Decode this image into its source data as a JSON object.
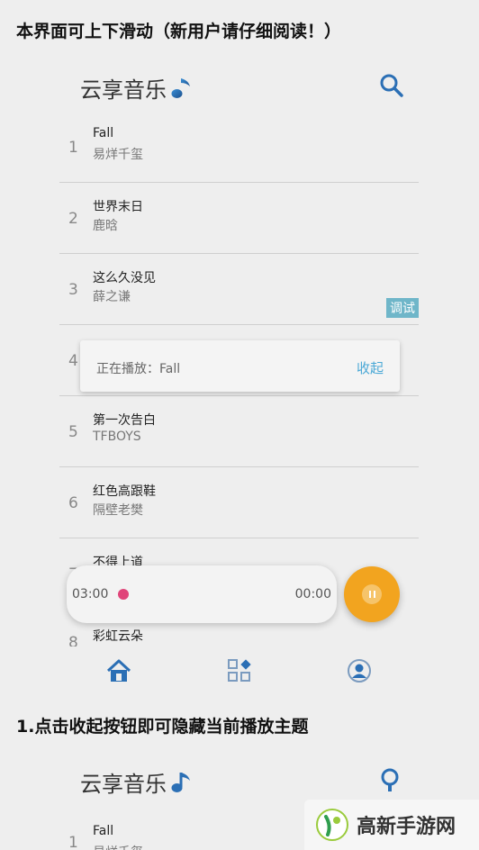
{
  "guide": {
    "heading_top": "本界面可上下滑动（新用户请仔细阅读！）",
    "heading_step1": "1.点击收起按钮即可隐藏当前播放主题"
  },
  "app": {
    "title": "云享音乐",
    "title_second": "云享音乐"
  },
  "songs": [
    {
      "index": "1",
      "title": "Fall",
      "artist": "易烊千玺"
    },
    {
      "index": "2",
      "title": "世界末日",
      "artist": "鹿晗"
    },
    {
      "index": "3",
      "title": "这么久没见",
      "artist": "薛之谦"
    },
    {
      "index": "4",
      "title": "",
      "artist": ""
    },
    {
      "index": "5",
      "title": "第一次告白",
      "artist": "TFBOYS"
    },
    {
      "index": "6",
      "title": "红色高跟鞋",
      "artist": "隔壁老樊"
    },
    {
      "index": "7",
      "title": "不得上道",
      "artist": ""
    },
    {
      "index": "8",
      "title": "彩虹云朵",
      "artist": ""
    }
  ],
  "debug_tag": "调试",
  "now_playing": {
    "text": "正在播放：Fall",
    "collapse_label": "收起"
  },
  "player": {
    "elapsed": "03:00",
    "remaining": "00:00",
    "progress": 0.0
  },
  "second_screen": {
    "first_song_index": "1",
    "first_song_title": "Fall",
    "first_song_artist": "易烊千玺"
  },
  "watermark": {
    "text": "高新手游网"
  },
  "colors": {
    "accent_blue": "#4aa8d6",
    "play_orange": "#f2a41f",
    "progress_dot": "#e0457a",
    "debug_tag": "#6fb6c9"
  }
}
